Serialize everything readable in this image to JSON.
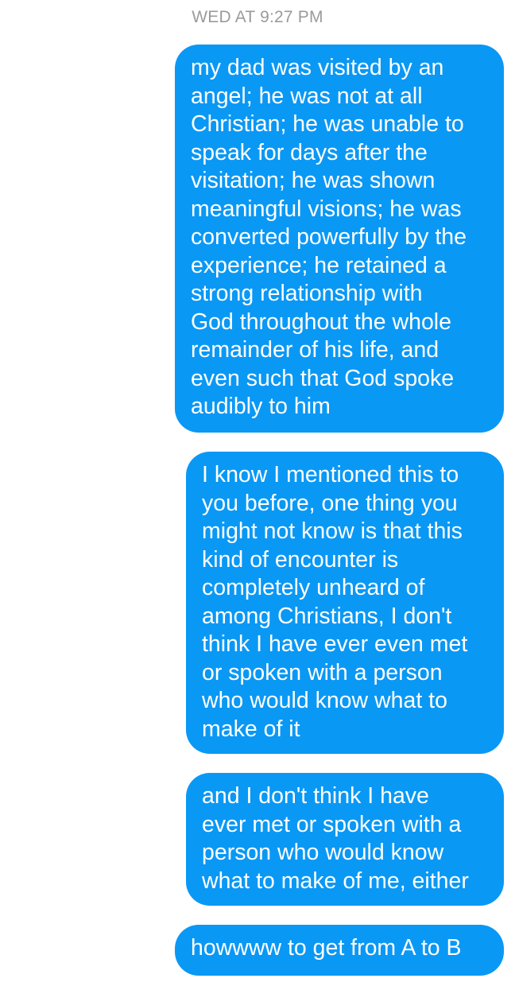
{
  "thread": {
    "timestamp": "WED AT 9:27 PM",
    "bubble_color": "#0a98f5",
    "messages": [
      {
        "sender": "me",
        "text": "my dad was visited by an\nangel; he was not at all\nChristian; he was unable to\nspeak for days after the\nvisitation; he was shown\nmeaningful visions; he was\nconverted powerfully by the\nexperience; he retained a\nstrong relationship with\nGod throughout the whole\nremainder of his life, and\neven such that God spoke\naudibly to him"
      },
      {
        "sender": "me",
        "text": "I know I mentioned this to\nyou before, one thing you\nmight not know is that this\nkind of encounter is\ncompletely unheard of\namong Christians, I don't\nthink I have ever even met\nor spoken with a person\nwho would know what to\nmake of it"
      },
      {
        "sender": "me",
        "text": "and I don't think I have\never met or spoken with a\nperson who would know\nwhat to make of me, either"
      },
      {
        "sender": "me",
        "text": "howwww to get from A to B"
      }
    ]
  }
}
